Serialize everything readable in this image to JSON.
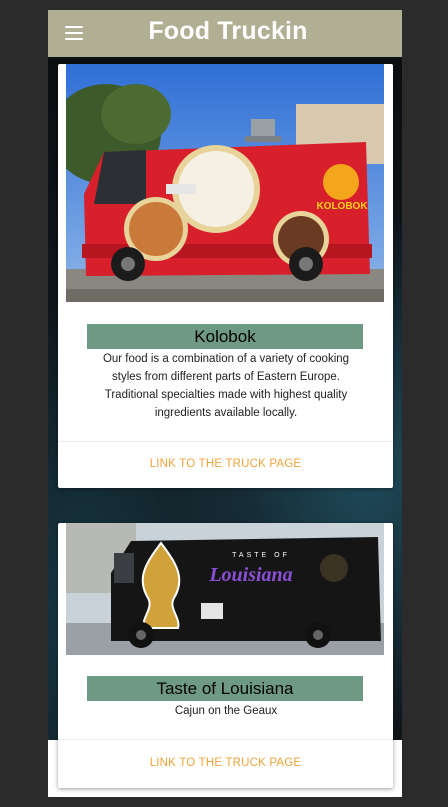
{
  "app": {
    "title": "Food Truckin"
  },
  "colors": {
    "header": "#b0ae93",
    "name_bar": "#6e9a84",
    "link": "#f0a33a"
  },
  "icons": {
    "menu": "hamburger-menu-icon"
  },
  "trucks": [
    {
      "name": "Kolobok",
      "description": "Our food is a combination of a variety of cooking styles from different parts of Eastern Europe. Traditional specialties made with highest quality ingredients available locally.",
      "link_label": "LINK TO THE TRUCK PAGE",
      "image_brand_text": "KOLOBOK"
    },
    {
      "name": "Taste of Louisiana",
      "description": "Cajun on the Geaux",
      "link_label": "LINK TO THE TRUCK PAGE",
      "image_brand_text": "Louisiana",
      "image_small_text": "TASTE OF"
    }
  ]
}
